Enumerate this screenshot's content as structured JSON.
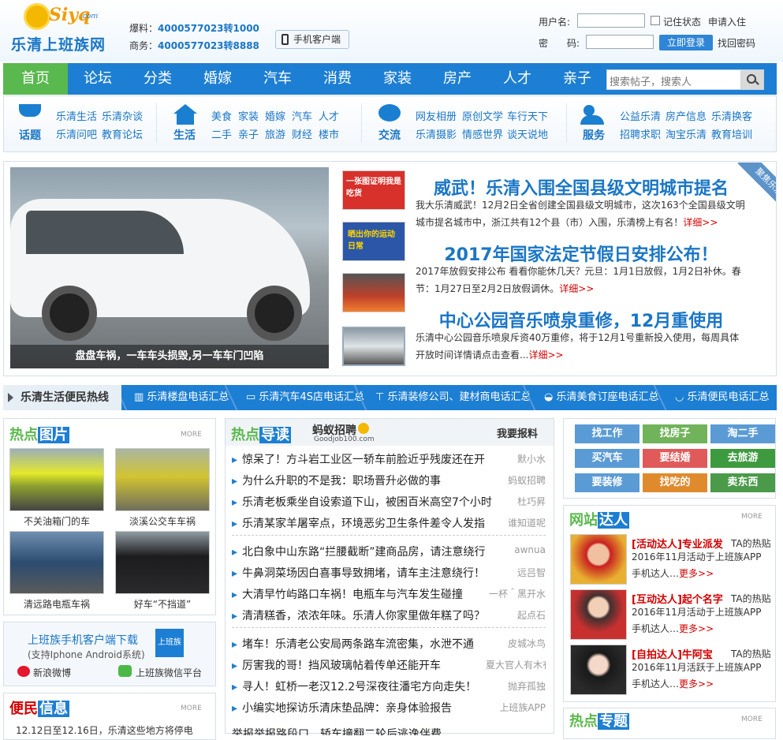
{
  "header": {
    "logo_word": "Siyq",
    "logo_domain": ".com",
    "site_name": "乐清上班族网",
    "tip_label": "爆料：",
    "tip_phone": "4000577023转1000",
    "biz_label": "商务：",
    "biz_phone": "4000577023转8888",
    "mobile_client": "手机客户端"
  },
  "login": {
    "username_label": "用户名:",
    "password_label": "密　　码:",
    "remember": "记住状态",
    "apply": "申请入住",
    "submit": "立即登录",
    "recover": "找回密码"
  },
  "nav": {
    "items": [
      "首页",
      "论坛",
      "分类",
      "婚嫁",
      "汽车",
      "消费",
      "家装",
      "房产",
      "人才",
      "亲子"
    ],
    "search_placeholder": "搜索帖子，搜索人"
  },
  "categories": [
    {
      "title": "话题",
      "links": [
        "乐清生活",
        "乐清杂谈",
        "乐清问吧",
        "教育论坛"
      ]
    },
    {
      "title": "生活",
      "links": [
        "美食",
        "家装",
        "婚嫁",
        "汽车",
        "人才",
        "二手",
        "亲子",
        "旅游",
        "财经",
        "楼市"
      ]
    },
    {
      "title": "交流",
      "links": [
        "网友相册",
        "原创文学",
        "车行天下",
        "乐清摄影",
        "情感世界",
        "谈天说地"
      ]
    },
    {
      "title": "服务",
      "links": [
        "公益乐清",
        "房产信息",
        "乐清换客",
        "招聘求职",
        "淘宝乐清",
        "教育培训"
      ]
    }
  ],
  "focus": {
    "photo_caption": "盘盘车祸，一车车头损毁,另一车车门凹陷",
    "ribbon": "聚焦乐清",
    "thumbs": [
      "一张图证明我是吃货",
      "晒出你的运动日常",
      "",
      ""
    ],
    "stories": [
      {
        "headline": "威武！乐清入围全国县级文明城市提名",
        "summary": "我大乐清威武！12月2日全省创建全国县级文明城市，这次163个全国县级文明城市提名城市中，浙江共有12个县（市）入围，乐清榜上有名！",
        "more": "详细>>"
      },
      {
        "headline": "2017年国家法定节假日安排公布！",
        "summary": "2017年放假安排公布 看看你能休几天？元旦：1月1日放假，1月2日补休。春节：1月27日至2月2日放假调休。",
        "more": "详细>>"
      },
      {
        "headline": "中心公园音乐喷泉重修，12月重使用",
        "summary": "乐清中心公园音乐喷泉斥资40万重修，将于12月1号重新投入使用，每周具体开放时间详情请点击查看...",
        "more": "详细>>"
      }
    ]
  },
  "hotbar": {
    "title": "乐清生活便民热线",
    "items": [
      "乐清楼盘电话汇总",
      "乐清汽车4S店电话汇总",
      "乐清装修公司、建材商电话汇总",
      "乐清美食订座电话汇总",
      "乐清便民电话汇总"
    ]
  },
  "hot_pics": {
    "title_a": "热点",
    "title_b": "图片",
    "more": "MORE",
    "items": [
      "不关油箱门的车",
      "淡溪公交车车祸",
      "清远路电瓶车祸",
      "好车“不挡道”"
    ]
  },
  "app_dl": {
    "title": "上班族手机客户端下载",
    "sub": "(支持Iphone  Android系统)",
    "weibo": "新浪微博",
    "wechat": "上班族微信平台",
    "badge": "上班族"
  },
  "convenience": {
    "title_a": "便民",
    "title_b": "信息",
    "more": "MORE",
    "first": "12.12日至12.16日，乐清这些地方将停电"
  },
  "hot_news": {
    "title_a": "热点",
    "title_b": "导读",
    "ad": "蚂蚁招聘",
    "ad_sub": "Goodjob100.com",
    "report": "我要报料",
    "groups": [
      [
        [
          "惊呆了！方斗岩工业区一轿车前脸近乎残废还在开",
          "默小水"
        ],
        [
          "为什么升职的不是我：职场晋升必做的事",
          "蚂蚁招聘"
        ],
        [
          "乐清老板乘坐自设索道下山，被困百米高空7个小时",
          "杜巧昇"
        ],
        [
          "乐清某家羊屠宰点，环境恶劣卫生条件差令人发指",
          "谁知道呢"
        ]
      ],
      [
        [
          "北白象中山东路“拦腰截断”建商品房，请注意绕行",
          "awnua"
        ],
        [
          "牛鼻洞菜场因白喜事导致拥堵，请车主注意绕行！",
          "远吕智"
        ],
        [
          "大清早竹屿路口车祸！电瓶车与汽车发生碰撞",
          "一杯＾黑开水"
        ],
        [
          "清清糕香，浓浓年味。乐清人你家里做年糕了吗？",
          "起点石"
        ]
      ],
      [
        [
          "堵车！乐清老公安局两条路车流密集，水泄不通",
          "皮城冰鸟"
        ],
        [
          "厉害我的哥！挡风玻璃帖着传单还能开车",
          "夏大官人有木有"
        ],
        [
          "寻人！虹桥一老汉12.2号深夜往潘宅方向走失！",
          "抛弃孤独"
        ],
        [
          "小编实地探访乐清床垫品牌：亲身体验报告",
          "上班族APP"
        ]
      ]
    ],
    "cut": "举报举报路段口…轿车撞翻二轮后逃逸伴费…"
  },
  "tags": [
    {
      "label": "找工作",
      "color": "#5b9bd5"
    },
    {
      "label": "找房子",
      "color": "#70b35a"
    },
    {
      "label": "淘二手",
      "color": "#5b9bd5"
    },
    {
      "label": "买汽车",
      "color": "#5b9bd5"
    },
    {
      "label": "要结婚",
      "color": "#e05a5a"
    },
    {
      "label": "去旅游",
      "color": "#3e9a3e"
    },
    {
      "label": "要装修",
      "color": "#5b9bd5"
    },
    {
      "label": "找吃的",
      "color": "#e08a2e"
    },
    {
      "label": "卖东西",
      "color": "#4a9a4a"
    }
  ],
  "experts": {
    "title_a": "网站",
    "title_b": "达人",
    "more": "MORE",
    "items": [
      {
        "tag": "[活动达人]专业派发",
        "link": "TA的热贴",
        "text": "2016年11月活动于上班族APP手机达人…",
        "more": "更多>>"
      },
      {
        "tag": "[互动达人]起个名字",
        "link": "TA的热贴",
        "text": "2016年11月活动于上班族APP手机达人…",
        "more": "更多>>"
      },
      {
        "tag": "[自拍达人]牛阿宝",
        "link": "TA的热贴",
        "text": "2016年11月活跃于上班族APP手机达人…",
        "more": "更多>>"
      }
    ]
  },
  "topics": {
    "title_a": "热点",
    "title_b": "专题",
    "more": "MORE"
  }
}
